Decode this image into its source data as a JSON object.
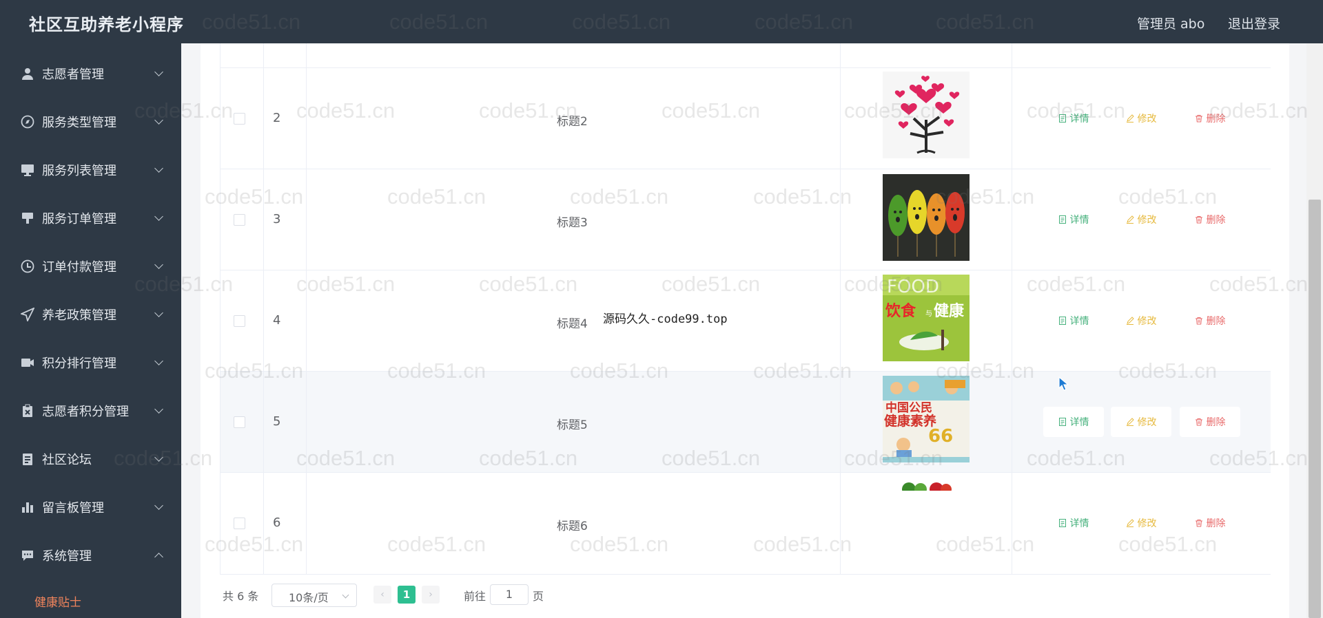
{
  "header": {
    "app_title": "社区互助养老小程序",
    "admin_label": "管理员 abo",
    "logout_label": "退出登录"
  },
  "sidebar": {
    "items": [
      {
        "label": "志愿者管理",
        "icon": "user-icon",
        "expanded": false
      },
      {
        "label": "服务类型管理",
        "icon": "compass-icon",
        "expanded": false
      },
      {
        "label": "服务列表管理",
        "icon": "monitor-icon",
        "expanded": false
      },
      {
        "label": "服务订单管理",
        "icon": "stamp-icon",
        "expanded": false
      },
      {
        "label": "订单付款管理",
        "icon": "clock-icon",
        "expanded": false
      },
      {
        "label": "养老政策管理",
        "icon": "send-icon",
        "expanded": false
      },
      {
        "label": "积分排行管理",
        "icon": "camera-icon",
        "expanded": false
      },
      {
        "label": "志愿者积分管理",
        "icon": "clipboard-icon",
        "expanded": false
      },
      {
        "label": "社区论坛",
        "icon": "document-icon",
        "expanded": false
      },
      {
        "label": "留言板管理",
        "icon": "bar-chart-icon",
        "expanded": false
      },
      {
        "label": "系统管理",
        "icon": "chat-icon",
        "expanded": true
      }
    ],
    "sub_item_active": "健康贴士",
    "active_color": "#f0845c"
  },
  "table": {
    "rows": [
      {
        "index": "2",
        "title": "标题2",
        "image": "heart-tree-image"
      },
      {
        "index": "3",
        "title": "标题3",
        "image": "leaves-faces-image"
      },
      {
        "index": "4",
        "title": "标题4",
        "image": "food-health-book-image"
      },
      {
        "index": "5",
        "title": "标题5",
        "image": "health-literacy-book-image"
      },
      {
        "index": "6",
        "title": "标题6",
        "image": "vegetables-image"
      }
    ],
    "actions": {
      "detail": "详情",
      "edit": "修改",
      "delete": "删除"
    },
    "colors": {
      "detail": "#44b07b",
      "edit": "#e6b93d",
      "delete": "#e86a6a"
    }
  },
  "pagination": {
    "total_text": "共 6 条",
    "page_size": "10条/页",
    "current_page": "1",
    "goto_label": "前往",
    "goto_value": "1",
    "page_word": "页",
    "active_color": "#2ebf91"
  },
  "overlay_text": "源码久久-code99.top",
  "watermark": "code51.cn"
}
